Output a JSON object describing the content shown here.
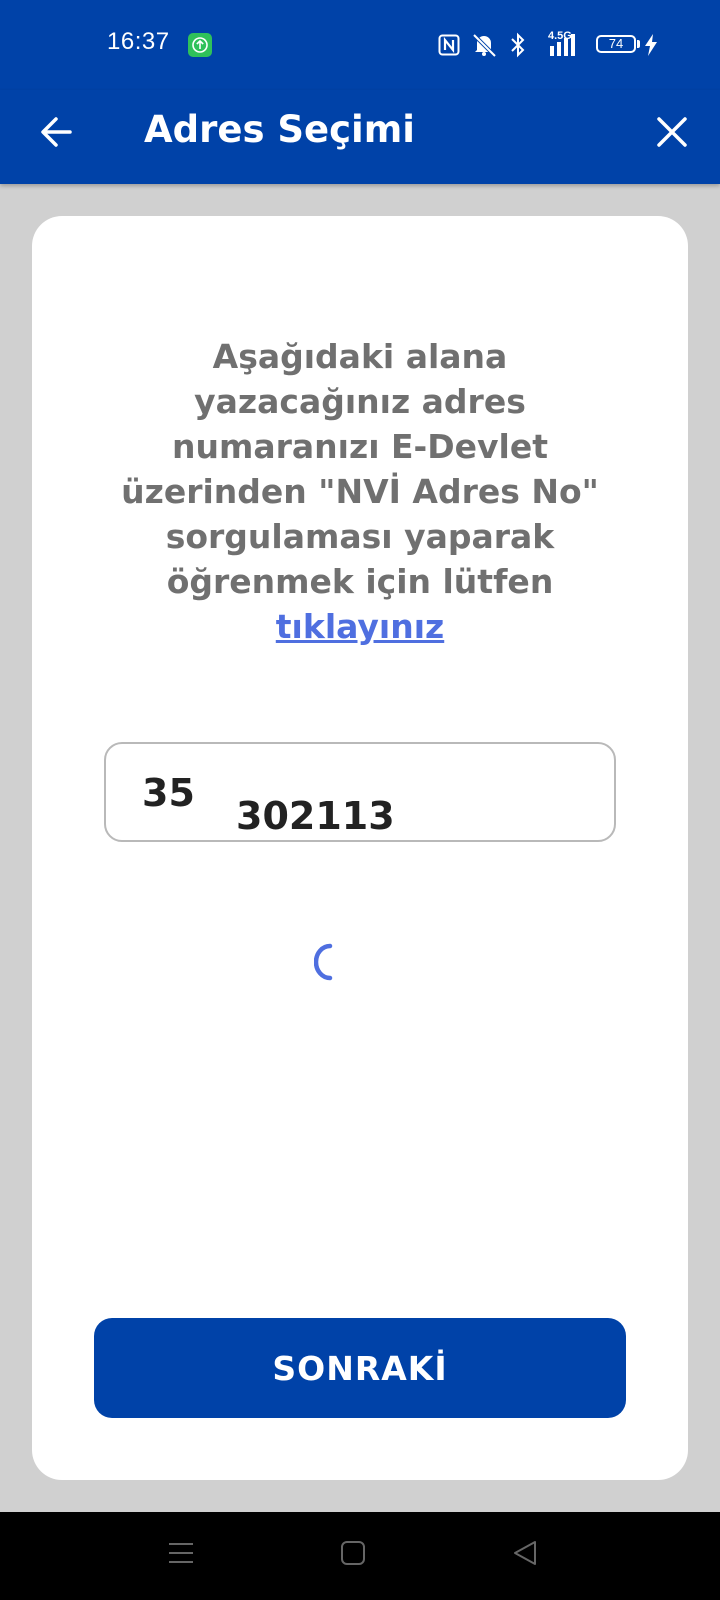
{
  "status_bar": {
    "time": "16:37",
    "network": "4.5G",
    "battery": "74",
    "icons": [
      "upload-app-icon",
      "nfc-icon",
      "mute-icon",
      "bluetooth-icon",
      "signal-icon",
      "battery-icon",
      "charging-icon"
    ]
  },
  "app_bar": {
    "title": "Adres Seçimi",
    "back_icon": "arrow-left-icon",
    "close_icon": "close-icon"
  },
  "main": {
    "info_text": "Aşağıdaki alana yazacağınız adres numaranızı E-Devlet üzerinden \"NVİ Adres No\" sorgulaması yaparak öğrenmek için lütfen",
    "info_link": "tıklayınız",
    "address_input": {
      "value": "35",
      "rolling_value": "302113"
    },
    "next_button": "SONRAKİ"
  },
  "colors": {
    "primary": "#0042a8",
    "link": "#4f6fe0",
    "text_gray": "#707070",
    "background": "#d0d0d0"
  },
  "nav_bar": {
    "icons": [
      "menu-icon",
      "home-icon",
      "back-triangle-icon"
    ]
  }
}
